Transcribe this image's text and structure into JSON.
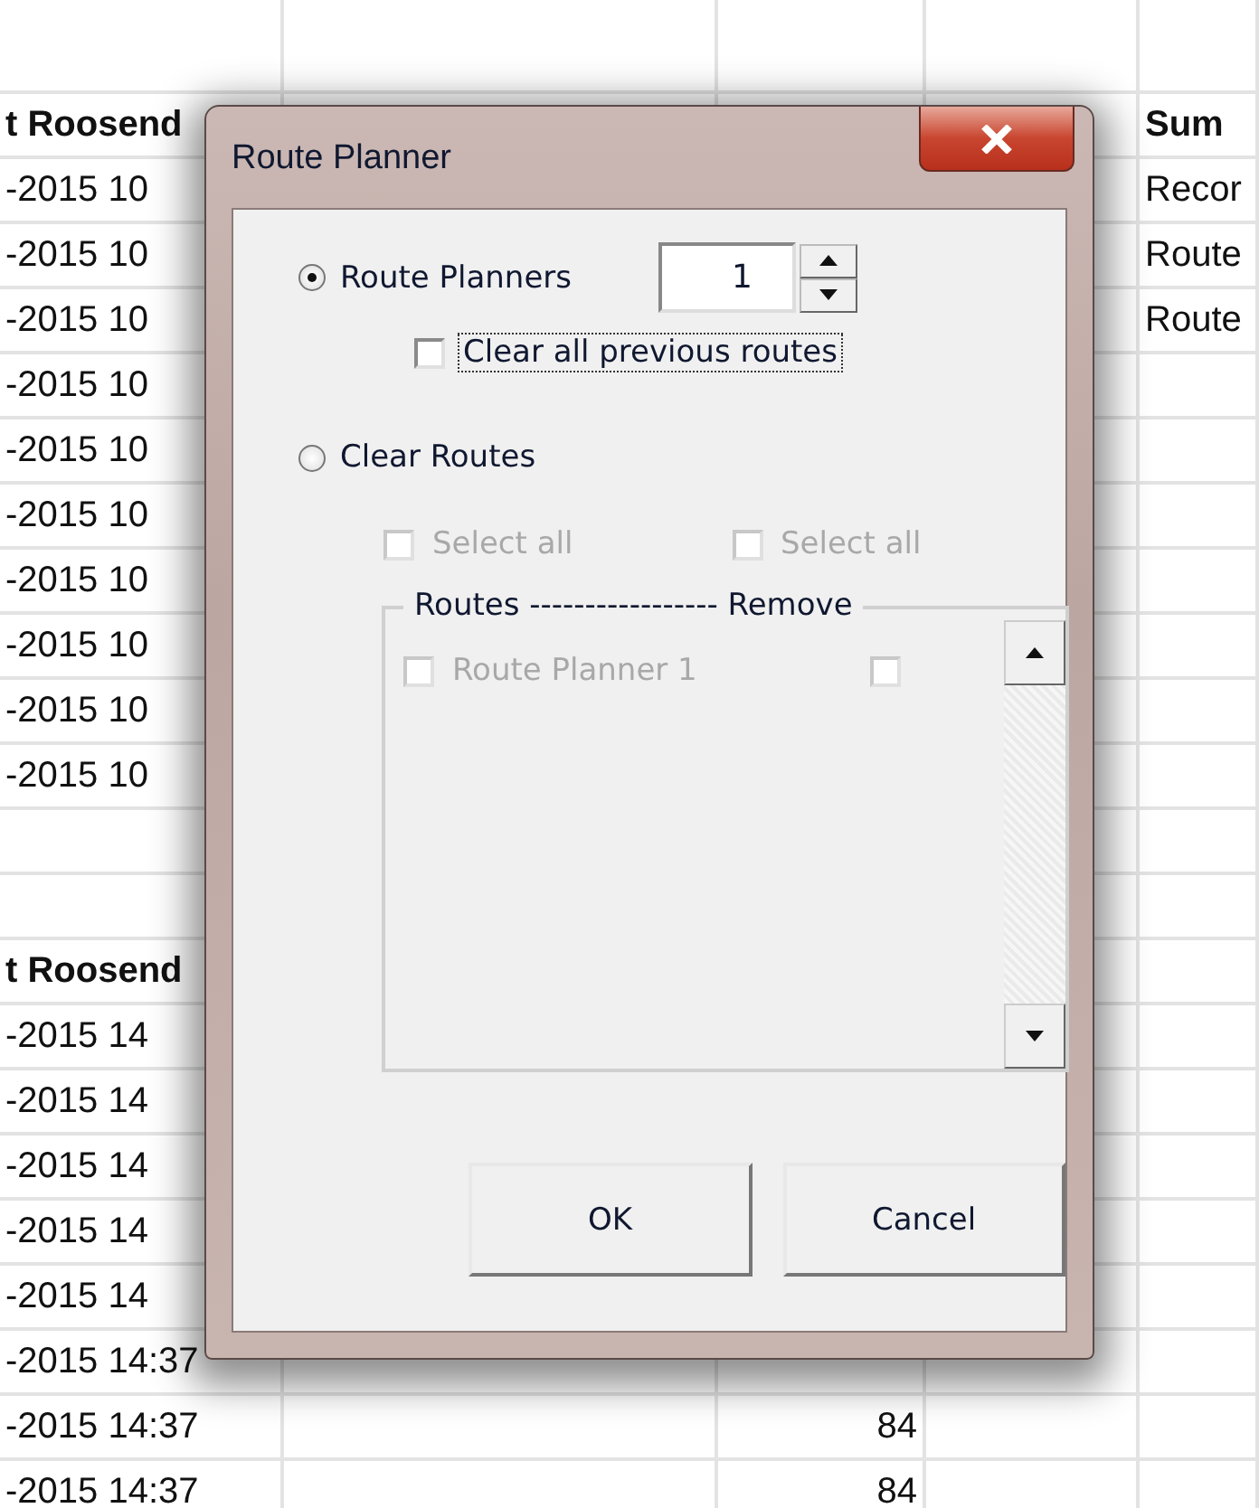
{
  "sheet": {
    "rows": [
      {
        "kind": "blank",
        "cells": {}
      },
      {
        "kind": "header",
        "cells": {
          "column_1": "t Roosend",
          "column_5": "Sum"
        }
      },
      {
        "kind": "data",
        "cells": {
          "column_1": "-2015 10",
          "column_5": "Recor"
        }
      },
      {
        "kind": "data",
        "cells": {
          "column_1": "-2015 10",
          "column_5": "Route"
        }
      },
      {
        "kind": "data",
        "cells": {
          "column_1": "-2015 10",
          "column_5": "Route"
        }
      },
      {
        "kind": "data",
        "cells": {
          "column_1": "-2015 10"
        }
      },
      {
        "kind": "data",
        "cells": {
          "column_1": "-2015 10"
        }
      },
      {
        "kind": "data",
        "cells": {
          "column_1": "-2015 10"
        }
      },
      {
        "kind": "data",
        "cells": {
          "column_1": "-2015 10"
        }
      },
      {
        "kind": "data",
        "cells": {
          "column_1": "-2015 10"
        }
      },
      {
        "kind": "data",
        "cells": {
          "column_1": "-2015 10"
        }
      },
      {
        "kind": "data",
        "cells": {
          "column_1": "-2015 10"
        }
      },
      {
        "kind": "blank",
        "cells": {}
      },
      {
        "kind": "blank",
        "cells": {}
      },
      {
        "kind": "header",
        "cells": {
          "column_1": "t Roosend"
        }
      },
      {
        "kind": "data",
        "cells": {
          "column_1": "-2015 14"
        }
      },
      {
        "kind": "data",
        "cells": {
          "column_1": "-2015 14"
        }
      },
      {
        "kind": "data",
        "cells": {
          "column_1": "-2015 14"
        }
      },
      {
        "kind": "data",
        "cells": {
          "column_1": "-2015 14"
        }
      },
      {
        "kind": "data",
        "cells": {
          "column_1": "-2015 14"
        }
      },
      {
        "kind": "data",
        "cells": {
          "column_1": "-2015 14:37"
        }
      },
      {
        "kind": "data",
        "cells": {
          "column_1": "-2015 14:37",
          "column_3": "84"
        }
      },
      {
        "kind": "data",
        "cells": {
          "column_1": "-2015 14:37",
          "column_3": "84"
        }
      }
    ]
  },
  "dialog": {
    "title": "Route Planner",
    "options": [
      {
        "label": "Route Planners",
        "selected": true
      },
      {
        "label": "Clear Routes",
        "selected": false
      }
    ],
    "planner_count": "1",
    "clear_previous": {
      "label": "Clear all previous routes",
      "checked": false
    },
    "select_all": [
      {
        "label": "Select all",
        "checked": false,
        "disabled": true
      },
      {
        "label": "Select all",
        "checked": false,
        "disabled": true
      }
    ],
    "routes_frame": {
      "legend": "Routes ----------------- Remove",
      "routes": [
        {
          "label": "Route Planner 1",
          "checked": false,
          "remove": false,
          "disabled": true
        }
      ]
    },
    "buttons": [
      "OK",
      "Cancel"
    ]
  }
}
